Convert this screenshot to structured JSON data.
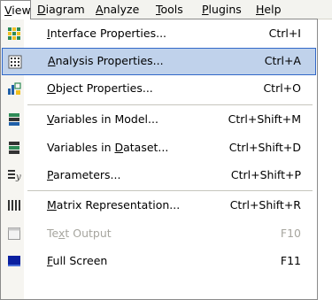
{
  "menubar": {
    "items": [
      {
        "first": "V",
        "rest": "iew"
      },
      {
        "first": "D",
        "rest": "iagram"
      },
      {
        "first": "A",
        "rest": "nalyze"
      },
      {
        "first": "T",
        "rest": "ools"
      },
      {
        "first": "P",
        "rest": "lugins"
      },
      {
        "first": "H",
        "rest": "elp"
      }
    ]
  },
  "menu": {
    "items": [
      {
        "pre": "",
        "key": "I",
        "post": "nterface Properties...",
        "shortcut": "Ctrl+I",
        "icon": "interface-properties-icon",
        "disabled": false,
        "highlighted": false
      },
      {
        "pre": "",
        "key": "A",
        "post": "nalysis Properties...",
        "shortcut": "Ctrl+A",
        "icon": "analysis-properties-icon",
        "disabled": false,
        "highlighted": true
      },
      {
        "pre": "",
        "key": "O",
        "post": "bject Properties...",
        "shortcut": "Ctrl+O",
        "icon": "object-properties-icon",
        "disabled": false,
        "highlighted": false
      },
      {
        "pre": "",
        "key": "V",
        "post": "ariables in Model...",
        "shortcut": "Ctrl+Shift+M",
        "icon": "variables-in-model-icon",
        "disabled": false,
        "highlighted": false
      },
      {
        "pre": "Variables in ",
        "key": "D",
        "post": "ataset...",
        "shortcut": "Ctrl+Shift+D",
        "icon": "variables-in-dataset-icon",
        "disabled": false,
        "highlighted": false
      },
      {
        "pre": "",
        "key": "P",
        "post": "arameters...",
        "shortcut": "Ctrl+Shift+P",
        "icon": "parameters-icon",
        "disabled": false,
        "highlighted": false
      },
      {
        "pre": "",
        "key": "M",
        "post": "atrix Representation...",
        "shortcut": "Ctrl+Shift+R",
        "icon": "matrix-representation-icon",
        "disabled": false,
        "highlighted": false
      },
      {
        "pre": "Te",
        "key": "x",
        "post": "t Output",
        "shortcut": "F10",
        "icon": "text-output-icon",
        "disabled": true,
        "highlighted": false
      },
      {
        "pre": "",
        "key": "F",
        "post": "ull Screen",
        "shortcut": "F11",
        "icon": "full-screen-icon",
        "disabled": false,
        "highlighted": false
      }
    ]
  }
}
